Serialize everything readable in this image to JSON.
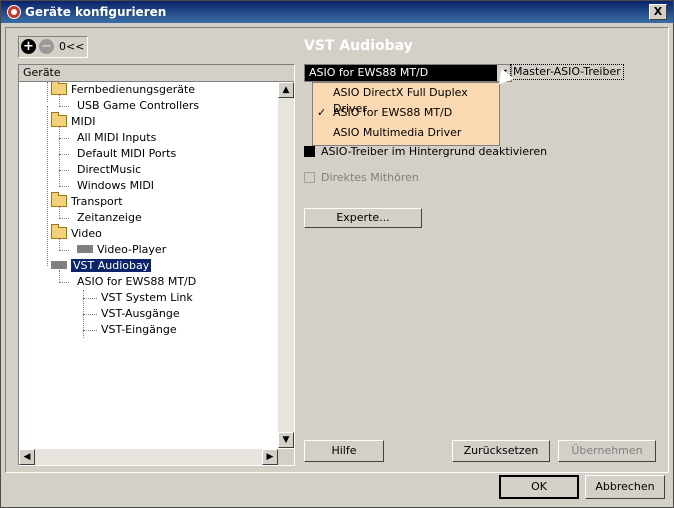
{
  "window": {
    "title": "Geräte konfigurieren",
    "close_label": "X"
  },
  "toolbar": {
    "add_label": "+",
    "remove_label": "−",
    "reset_label": "0<<"
  },
  "tree": {
    "header": "Geräte",
    "items": [
      {
        "label": "Fernbedienungsgeräte"
      },
      {
        "label": "USB Game Controllers"
      },
      {
        "label": "MIDI"
      },
      {
        "label": "All MIDI Inputs"
      },
      {
        "label": "Default MIDI Ports"
      },
      {
        "label": "DirectMusic"
      },
      {
        "label": "Windows MIDI"
      },
      {
        "label": "Transport"
      },
      {
        "label": "Zeitanzeige"
      },
      {
        "label": "Video"
      },
      {
        "label": "Video-Player"
      },
      {
        "label": "VST Audiobay"
      },
      {
        "label": "ASIO for EWS88 MT/D"
      },
      {
        "label": "VST System Link"
      },
      {
        "label": "VST-Ausgänge"
      },
      {
        "label": "VST-Eingänge"
      }
    ]
  },
  "panel": {
    "title": "VST Audiobay",
    "asio_combo_value": "ASIO for EWS88 MT/D",
    "master_label": "Master-ASIO-Treiber",
    "dropdown_options": [
      {
        "label": "ASIO DirectX Full Duplex Driver",
        "check": ""
      },
      {
        "label": "ASIO for EWS88 MT/D",
        "check": "✓"
      },
      {
        "label": "ASIO Multimedia Driver",
        "check": ""
      }
    ],
    "asio_bg_label": "ASIO-Treiber im Hintergrund deaktivieren",
    "direct_monitor_label": "Direktes Mithören",
    "expert_button": "Experte...",
    "help_button": "Hilfe",
    "reset_button": "Zurücksetzen",
    "apply_button": "Übernehmen"
  },
  "footer": {
    "ok_button": "OK",
    "cancel_button": "Abbrechen"
  },
  "colors": {
    "title_bar": "#0a246a",
    "selection": "#0a246a",
    "dropdown_bg": "#fbd9b2"
  }
}
